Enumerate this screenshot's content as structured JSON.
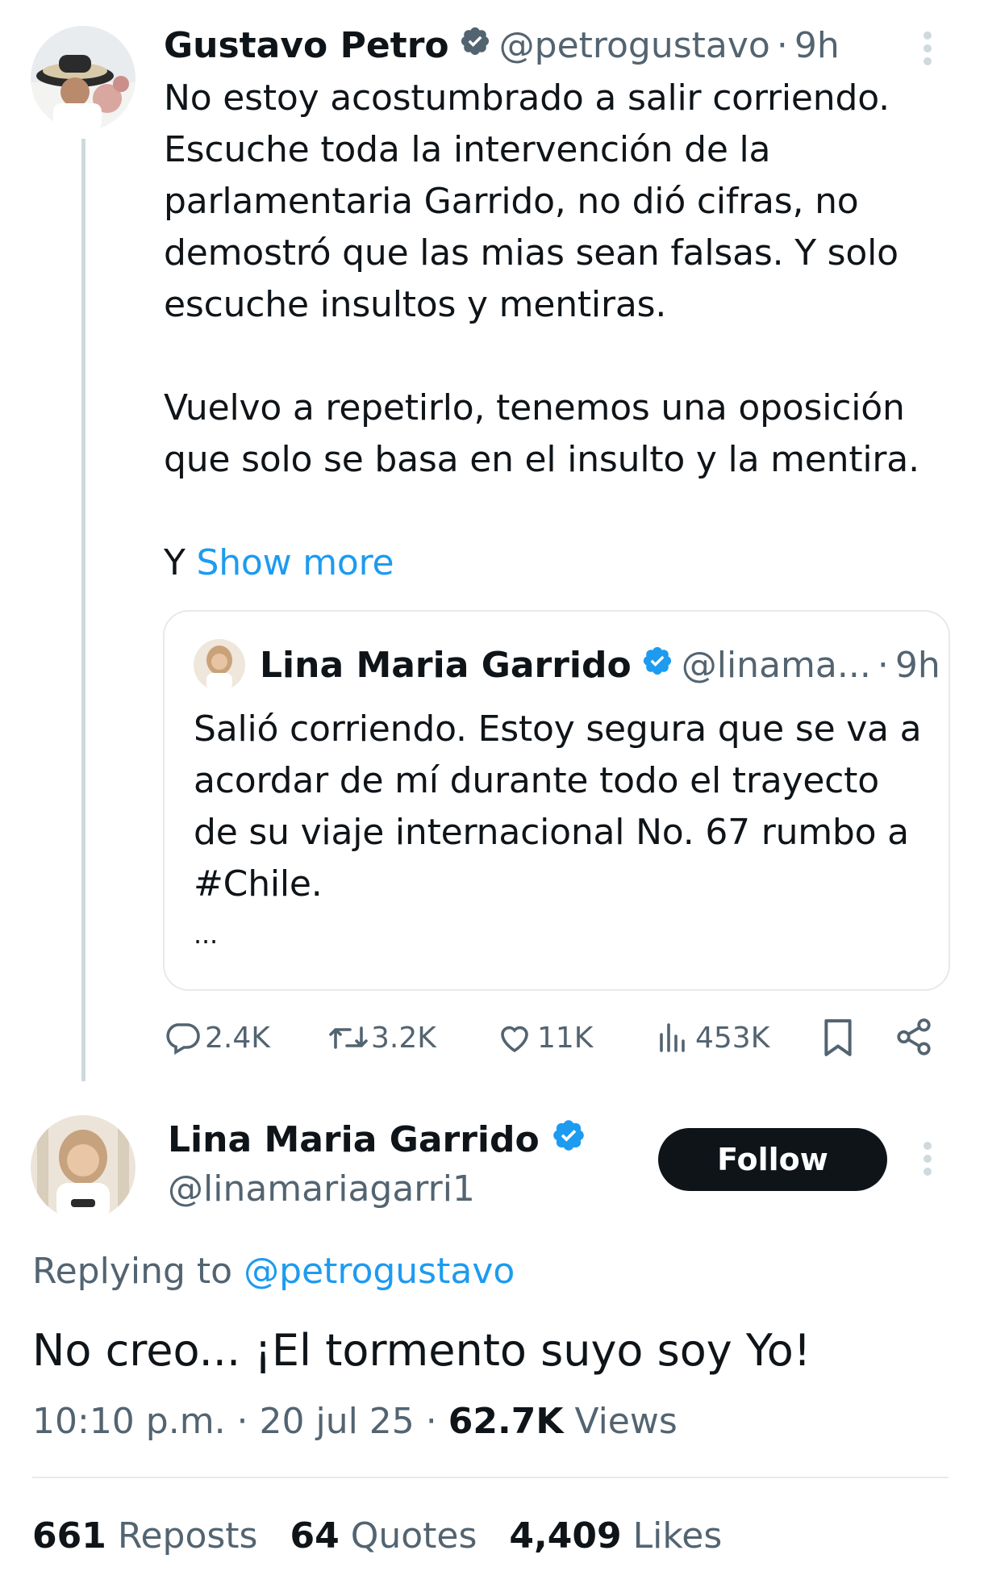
{
  "original_post": {
    "author_name": "Gustavo Petro",
    "author_handle": "@petrogustavo",
    "time": "9h",
    "paragraph1_lines": [
      "No estoy acostumbrado a salir corriendo.",
      "Escuche toda la intervención de la",
      "parlamentaria Garrido, no dió cifras, no",
      "demostró que las mias sean falsas. Y solo",
      "escuche insultos y mentiras."
    ],
    "paragraph2_lines": [
      "Vuelvo a repetirlo, tenemos una oposición",
      "que solo se basa en el insulto y la mentira."
    ],
    "truncated_start": "Y",
    "show_more": "Show more",
    "quoted": {
      "author_name": "Lina Maria Garrido",
      "author_handle": "@linama...",
      "time": "9h",
      "lines": [
        "Salió corriendo. Estoy segura que se va a",
        "acordar de mí durante todo el trayecto",
        "de su viaje internacional No. 67 rumbo a",
        "#Chile."
      ],
      "ellipsis": "..."
    },
    "stats": {
      "replies": "2.4K",
      "reposts": "3.2K",
      "likes": "11K",
      "views": "453K"
    }
  },
  "reply_post": {
    "author_name": "Lina Maria Garrido",
    "author_handle": "@linamariagarri1",
    "follow_label": "Follow",
    "replying_to_label": "Replying to",
    "replying_to_handle": "@petrogustavo",
    "text": "No creo... ¡El tormento suyo soy Yo!",
    "timestamp": "10:10 p.m. · 20 jul 25 ·",
    "views_count": "62.7K",
    "views_label": "Views",
    "reposts_count": "661",
    "reposts_label": "Reposts",
    "quotes_count": "64",
    "quotes_label": "Quotes",
    "likes_count": "4,409",
    "likes_label": "Likes"
  },
  "colors": {
    "accent": "#1d9bf0",
    "text": "#0f1419",
    "muted": "#536471",
    "border": "#e7e9ea"
  },
  "icons": [
    "verified-badge-icon",
    "more-options-icon",
    "reply-icon",
    "repost-icon",
    "like-icon",
    "views-icon",
    "bookmark-icon",
    "share-icon"
  ]
}
